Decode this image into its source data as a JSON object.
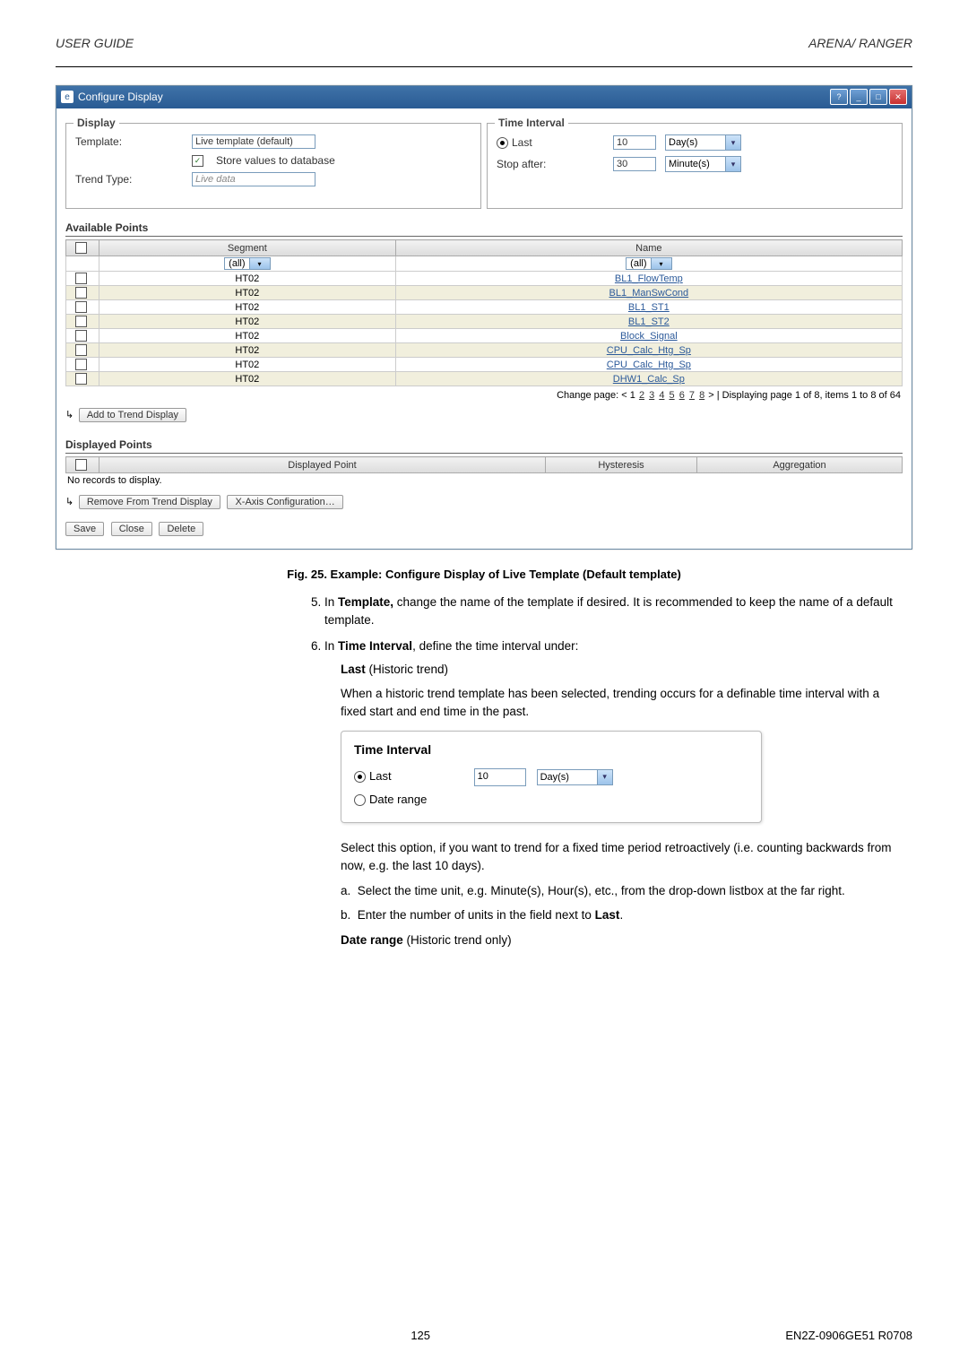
{
  "header": {
    "left": "USER GUIDE",
    "right": "ARENA/ RANGER"
  },
  "window": {
    "title": "Configure Display",
    "display": {
      "heading": "Display",
      "template_label": "Template:",
      "template_value": "Live template (default)",
      "store_label": "Store values to database",
      "store_checked": true,
      "trend_label": "Trend Type:",
      "trend_value": "Live data"
    },
    "time": {
      "heading": "Time Interval",
      "last_label": "Last",
      "last_value": "10",
      "last_unit": "Day(s)",
      "stop_label": "Stop after:",
      "stop_value": "30",
      "stop_unit": "Minute(s)"
    },
    "available": {
      "heading": "Available Points",
      "col_segment": "Segment",
      "col_name": "Name",
      "filter_all": "(all)",
      "rows": [
        {
          "segment": "HT02",
          "name": "BL1_FlowTemp"
        },
        {
          "segment": "HT02",
          "name": "BL1_ManSwCond"
        },
        {
          "segment": "HT02",
          "name": "BL1_ST1"
        },
        {
          "segment": "HT02",
          "name": "BL1_ST2"
        },
        {
          "segment": "HT02",
          "name": "Block_Signal"
        },
        {
          "segment": "HT02",
          "name": "CPU_Calc_Htg_Sp"
        },
        {
          "segment": "HT02",
          "name": "CPU_Calc_Htg_Sp"
        },
        {
          "segment": "HT02",
          "name": "DHW1_Calc_Sp"
        }
      ],
      "paging_prefix": "Change page: < ",
      "paging_pages": [
        "1",
        "2",
        "3",
        "4",
        "5",
        "6",
        "7",
        "8"
      ],
      "paging_suffix": " >   |   Displaying page 1 of 8, items 1 to 8 of 64",
      "add_btn": "Add to Trend Display"
    },
    "displayed": {
      "heading": "Displayed Points",
      "col_point": "Displayed Point",
      "col_hyst": "Hysteresis",
      "col_agg": "Aggregation",
      "empty": "No records to display.",
      "remove_btn": "Remove From Trend Display",
      "xaxis_btn": "X-Axis Configuration…"
    },
    "footer_buttons": {
      "save": "Save",
      "close": "Close",
      "delete": "Delete"
    }
  },
  "caption": "Fig. 25.  Example: Configure Display of Live Template (Default template)",
  "doc": {
    "item5_pre": "In ",
    "item5_bold": "Template,",
    "item5_post": " change the name of the template if desired. It is recommended to keep the name of a default template.",
    "item6_pre": "In ",
    "item6_bold": "Time Interval",
    "item6_post": ", define the time interval under:",
    "last_bold": "Last",
    "last_paren": " (Historic trend)",
    "last_para": "When a historic trend template has been selected, trending occurs for a definable time interval with a fixed start and end time in the past.",
    "mini": {
      "title": "Time Interval",
      "last": "Last",
      "value": "10",
      "unit": "Day(s)",
      "date_range": "Date range"
    },
    "select_para": "Select this option, if you want to trend for a fixed time period retroactively (i.e. counting backwards from now, e.g. the last 10 days).",
    "step_a": "Select the time unit, e.g. Minute(s), Hour(s), etc., from the drop-down listbox at the far right.",
    "step_b_pre": "Enter the number of units in the field next to ",
    "step_b_bold": "Last",
    "date_range_bold": "Date range",
    "date_range_paren": " (Historic trend only)"
  },
  "footer": {
    "page": "125",
    "doc_id": "EN2Z-0906GE51 R0708"
  }
}
